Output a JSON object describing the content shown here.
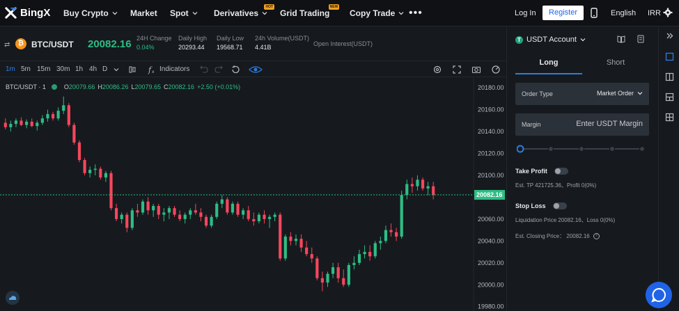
{
  "brand": {
    "name": "BingX"
  },
  "nav": {
    "items": [
      "Buy Crypto",
      "Market",
      "Spot",
      "Derivatives",
      "Grid Trading",
      "Copy Trade"
    ],
    "hot_badge": "HOT",
    "new_badge": "NEW",
    "login": "Log In",
    "register": "Register",
    "language": "English",
    "currency": "IRR"
  },
  "ticker": {
    "pair": "BTC/USDT",
    "last_price": "20082.16",
    "change_label": "24H Change",
    "change_value": "0.04%",
    "high_label": "Daily High",
    "high_value": "20293.44",
    "low_label": "Daily Low",
    "low_value": "19568.71",
    "volume_label": "24h Volume(USDT)",
    "volume_value": "4.41B",
    "oi_label": "Open Interest(USDT)"
  },
  "toolbar": {
    "timeframes": [
      "1m",
      "5m",
      "15m",
      "30m",
      "1h",
      "4h",
      "D"
    ],
    "active_timeframe": "1m",
    "indicators": "Indicators"
  },
  "chart_legend": {
    "symbol": "BTC/USDT · 1",
    "o_label": "O",
    "o_value": "20079.66",
    "h_label": "H",
    "h_value": "20086.26",
    "l_label": "L",
    "l_value": "20079.65",
    "c_label": "C",
    "c_value": "20082.16",
    "change": "+2.50 (+0.01%)"
  },
  "chart_data": {
    "type": "candlestick",
    "y_ticks": [
      20180,
      20160,
      20140,
      20120,
      20100,
      20080,
      20060,
      20040,
      20020,
      20000,
      19980
    ],
    "ylim": [
      19976,
      20189
    ],
    "current_price": "20082.16",
    "up_color": "#2ebd85",
    "down_color": "#f6465d",
    "candles": [
      [
        20148,
        20152,
        20142,
        20144
      ],
      [
        20144,
        20150,
        20140,
        20147
      ],
      [
        20147,
        20152,
        20144,
        20150
      ],
      [
        20150,
        20153,
        20145,
        20146
      ],
      [
        20146,
        20151,
        20143,
        20149
      ],
      [
        20149,
        20152,
        20144,
        20145
      ],
      [
        20145,
        20150,
        20141,
        20148
      ],
      [
        20148,
        20155,
        20146,
        20152
      ],
      [
        20152,
        20160,
        20149,
        20156
      ],
      [
        20156,
        20158,
        20150,
        20152
      ],
      [
        20152,
        20162,
        20150,
        20159
      ],
      [
        20159,
        20172,
        20156,
        20164
      ],
      [
        20164,
        20166,
        20144,
        20146
      ],
      [
        20146,
        20148,
        20128,
        20130
      ],
      [
        20130,
        20132,
        20112,
        20114
      ],
      [
        20114,
        20116,
        20100,
        20102
      ],
      [
        20102,
        20108,
        20098,
        20105
      ],
      [
        20105,
        20110,
        20100,
        20106
      ],
      [
        20106,
        20108,
        20096,
        20098
      ],
      [
        20098,
        20104,
        20094,
        20102
      ],
      [
        20102,
        20104,
        20068,
        20070
      ],
      [
        20070,
        20074,
        20058,
        20060
      ],
      [
        20060,
        20066,
        20056,
        20064
      ],
      [
        20064,
        20066,
        20048,
        20052
      ],
      [
        20052,
        20070,
        20050,
        20068
      ],
      [
        20068,
        20074,
        20062,
        20066
      ],
      [
        20066,
        20078,
        20064,
        20076
      ],
      [
        20076,
        20080,
        20064,
        20068
      ],
      [
        20068,
        20074,
        20062,
        20072
      ],
      [
        20072,
        20074,
        20060,
        20064
      ],
      [
        20064,
        20070,
        20058,
        20066
      ],
      [
        20066,
        20072,
        20060,
        20070
      ],
      [
        20070,
        20072,
        20062,
        20064
      ],
      [
        20064,
        20068,
        20058,
        20060
      ],
      [
        20060,
        20066,
        20056,
        20064
      ],
      [
        20064,
        20070,
        20060,
        20068
      ],
      [
        20068,
        20074,
        20064,
        20066
      ],
      [
        20066,
        20070,
        20058,
        20062
      ],
      [
        20062,
        20064,
        20052,
        20054
      ],
      [
        20054,
        20064,
        20052,
        20062
      ],
      [
        20062,
        20076,
        20060,
        20074
      ],
      [
        20074,
        20082,
        20070,
        20078
      ],
      [
        20078,
        20080,
        20064,
        20066
      ],
      [
        20066,
        20076,
        20064,
        20074
      ],
      [
        20074,
        20076,
        20062,
        20064
      ],
      [
        20064,
        20070,
        20060,
        20068
      ],
      [
        20068,
        20072,
        20058,
        20060
      ],
      [
        20060,
        20066,
        20054,
        20058
      ],
      [
        20058,
        20066,
        20056,
        20064
      ],
      [
        20064,
        20068,
        20056,
        20060
      ],
      [
        20060,
        20064,
        20052,
        20062
      ],
      [
        20062,
        20066,
        20058,
        20064
      ],
      [
        20064,
        20066,
        20022,
        20024
      ],
      [
        20024,
        20046,
        20022,
        20044
      ],
      [
        20044,
        20048,
        20036,
        20040
      ],
      [
        20040,
        20046,
        20036,
        20042
      ],
      [
        20042,
        20046,
        20030,
        20034
      ],
      [
        20034,
        20040,
        20026,
        20028
      ],
      [
        20028,
        20034,
        20020,
        20024
      ],
      [
        20024,
        20026,
        20004,
        20006
      ],
      [
        20006,
        20012,
        19994,
        20002
      ],
      [
        20002,
        20012,
        19998,
        20010
      ],
      [
        20010,
        20020,
        20006,
        20016
      ],
      [
        20016,
        20020,
        20002,
        20006
      ],
      [
        20006,
        20014,
        19998,
        20000
      ],
      [
        20000,
        20020,
        19998,
        20018
      ],
      [
        20018,
        20026,
        20014,
        20020
      ],
      [
        20020,
        20032,
        20018,
        20028
      ],
      [
        20028,
        20036,
        20024,
        20030
      ],
      [
        20030,
        20036,
        20022,
        20026
      ],
      [
        20026,
        20040,
        20024,
        20038
      ],
      [
        20038,
        20044,
        20032,
        20040
      ],
      [
        20040,
        20054,
        20038,
        20050
      ],
      [
        20050,
        20056,
        20044,
        20048
      ],
      [
        20048,
        20052,
        20040,
        20044
      ],
      [
        20044,
        20086,
        20042,
        20082
      ],
      [
        20082,
        20096,
        20078,
        20092
      ],
      [
        20092,
        20098,
        20084,
        20090
      ],
      [
        20090,
        20100,
        20086,
        20096
      ],
      [
        20096,
        20098,
        20086,
        20088
      ],
      [
        20088,
        20094,
        20082,
        20090
      ],
      [
        20090,
        20094,
        20078,
        20082
      ]
    ]
  },
  "panel": {
    "account": "USDT Account",
    "tab_long": "Long",
    "tab_short": "Short",
    "order_type_label": "Order Type",
    "order_type_value": "Market Order",
    "margin_label": "Margin",
    "margin_placeholder": "Enter USDT Margin",
    "take_profit": "Take Profit",
    "tp_info": "Est. TP 421725.36、Profit 0(0%)",
    "stop_loss": "Stop Loss",
    "sl_info": "Liquidation Price 20082.16、Loss 0(0%)",
    "closing_info": "Est. Closing Price： 20082.16"
  }
}
